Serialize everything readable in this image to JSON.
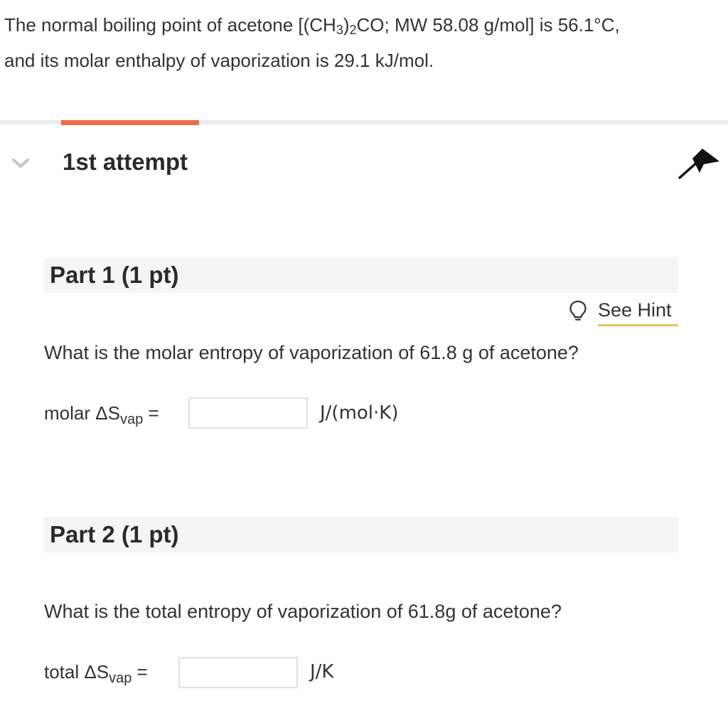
{
  "problem": {
    "line1_pre": "The normal boiling point of acetone [(CH",
    "sub1": "3",
    "line1_mid": ")",
    "sub2": "2",
    "line1_post": "CO; MW 58.08 g/mol] is 56.1°C,",
    "line2": "and its molar enthalpy of vaporization is 29.1 kJ/mol."
  },
  "attempt": {
    "title": "1st attempt"
  },
  "icons": {
    "expand": "chevron-down-icon",
    "flag": "flag-icon",
    "hint": "lightbulb-icon"
  },
  "colors": {
    "tab_accent": "#ee6b48",
    "hint_underline": "#e6c35c",
    "part_header_bg": "#f5f5f5"
  },
  "part1": {
    "title": "Part 1 (1 pt)",
    "hint_label": "See Hint",
    "question": "What is the molar entropy of vaporization of 61.8 g of acetone?",
    "answer_prefix": "molar ΔS",
    "answer_sub": "vap",
    "answer_eq": " =",
    "answer_value": "",
    "unit": "J/(mol·K)"
  },
  "part2": {
    "title": "Part 2 (1 pt)",
    "question": "What is the total entropy of vaporization of 61.8g of acetone?",
    "answer_prefix": "total ΔS",
    "answer_sub": "vap",
    "answer_eq": " =",
    "answer_value": "",
    "unit": "J/K"
  }
}
